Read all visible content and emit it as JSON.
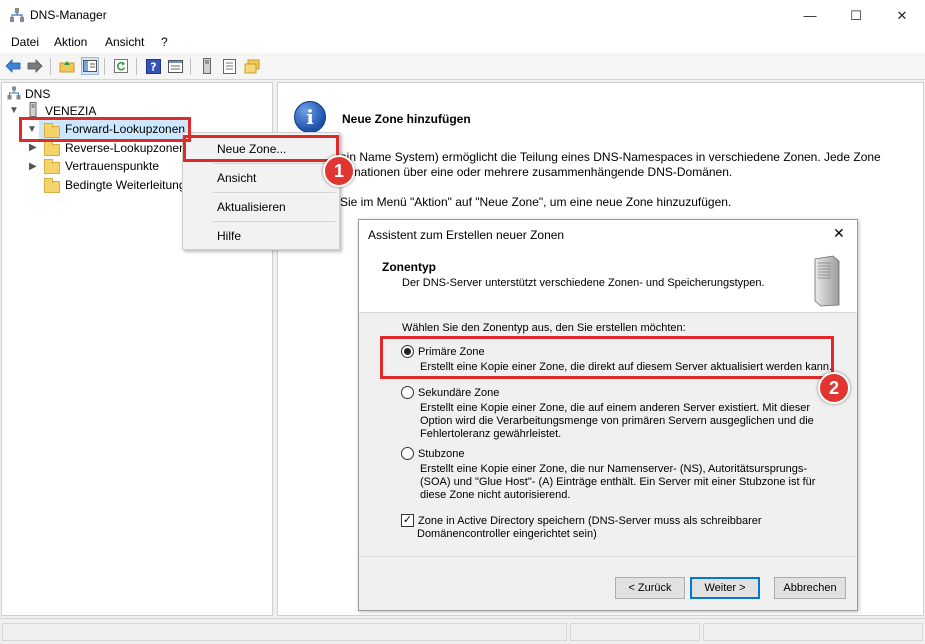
{
  "window": {
    "title": "DNS-Manager",
    "controls": {
      "minimize": "—",
      "maximize": "☐",
      "close": "✕"
    }
  },
  "menubar": {
    "items": [
      "Datei",
      "Aktion",
      "Ansicht",
      "?"
    ]
  },
  "toolbar": {
    "icons": [
      "back-icon",
      "forward-icon",
      "up-folder-icon",
      "show-hide-tree-icon",
      "refresh-icon",
      "help-icon",
      "properties-icon",
      "server-icon",
      "list-icon",
      "folders-icon"
    ]
  },
  "tree": {
    "root": "DNS",
    "server": "VENEZIA",
    "items": [
      "Forward-Lookupzonen",
      "Reverse-Lookupzonen",
      "Vertrauenspunkte",
      "Bedingte Weiterleitungen"
    ]
  },
  "context_menu": {
    "items": [
      "Neue Zone...",
      "Ansicht",
      "Aktualisieren",
      "Hilfe"
    ]
  },
  "annotations": {
    "badge1": "1",
    "badge2": "2",
    "color": "#e02a2a"
  },
  "info": {
    "heading": "Neue Zone hinzufügen",
    "line1": "ain Name System) ermöglicht die Teilung eines DNS-Namespaces in verschiedene Zonen. Jede Zone",
    "line2": "ormationen über eine oder mehrere zusammenhängende DNS-Domänen.",
    "line3": "Sie im Menü \"Aktion\" auf \"Neue Zone\", um eine neue Zone hinzuzufügen."
  },
  "wizard": {
    "title": "Assistent zum Erstellen neuer Zonen",
    "close": "✕",
    "header_title": "Zonentyp",
    "header_subtitle": "Der DNS-Server unterstützt verschiedene Zonen- und Speicherungstypen.",
    "prompt": "Wählen Sie den Zonentyp aus, den Sie erstellen möchten:",
    "options": [
      {
        "label": "Primäre Zone",
        "selected": true,
        "desc": [
          "Erstellt eine Kopie einer Zone, die direkt auf diesem Server aktualisiert werden kann."
        ]
      },
      {
        "label": "Sekundäre Zone",
        "selected": false,
        "desc": [
          "Erstellt eine Kopie einer Zone, die auf einem anderen Server existiert. Mit dieser",
          "Option wird die Verarbeitungsmenge von primären Servern ausgeglichen und die",
          "Fehlertoleranz gewährleistet."
        ]
      },
      {
        "label": "Stubzone",
        "selected": false,
        "desc": [
          "Erstellt eine Kopie einer Zone, die nur Namenserver- (NS), Autoritätsursprungs-",
          "(SOA) und \"Glue Host\"- (A) Einträge enthält. Ein Server mit einer Stubzone ist für",
          "diese Zone nicht autorisierend."
        ]
      }
    ],
    "ad_checkbox": {
      "checked": true,
      "label": "Zone in Active Directory speichern (DNS-Server muss als schreibbarer",
      "label2": "Domänencontroller eingerichtet sein)"
    },
    "buttons": {
      "back": "< Zurück",
      "next": "Weiter >",
      "cancel": "Abbrechen"
    }
  }
}
